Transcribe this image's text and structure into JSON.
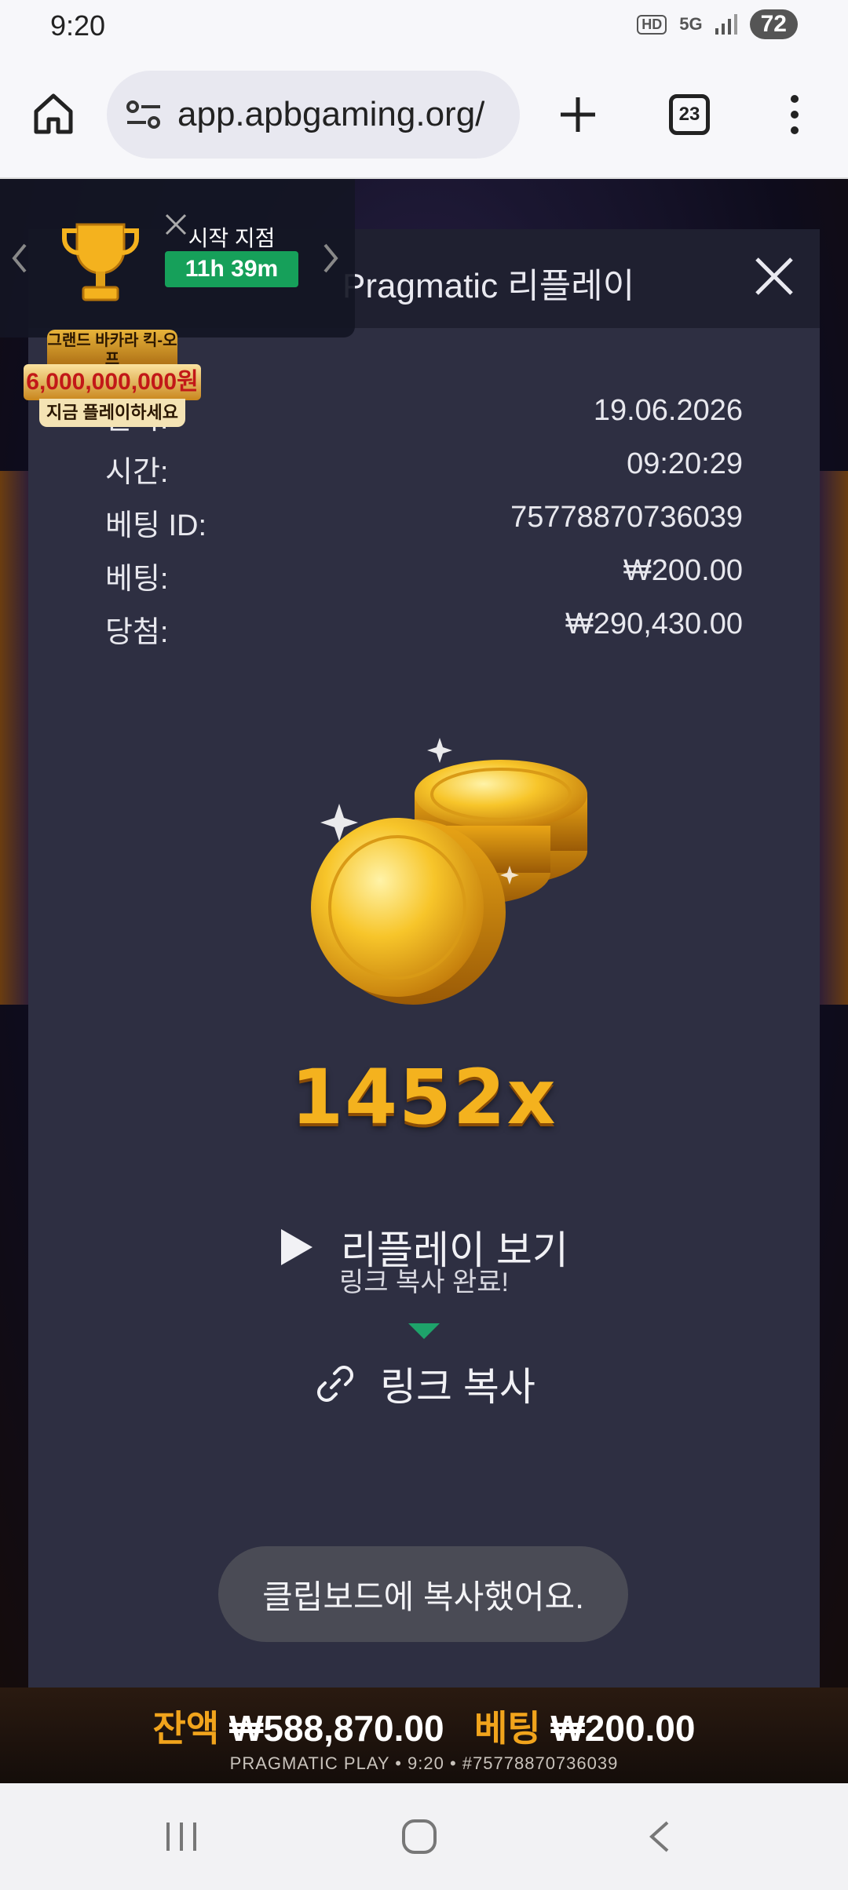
{
  "status_bar": {
    "time": "9:20",
    "hd": "HD",
    "network": "5G",
    "battery": "72"
  },
  "browser": {
    "url": "app.apbgaming.org/",
    "tab_count": "23"
  },
  "promo": {
    "label": "시작 지점",
    "timer": "11h 39m",
    "badge_title": "그랜드 바카라 킥-오프",
    "badge_amount": "6,000,000,000원",
    "badge_cta": "지금 플레이하세요"
  },
  "dialog": {
    "title": "Pragmatic 리플레이",
    "rows": [
      {
        "label": "날짜:",
        "value": "19.06.2026"
      },
      {
        "label": "시간:",
        "value": "09:20:29"
      },
      {
        "label": "베팅 ID:",
        "value": "75778870736039"
      },
      {
        "label": "베팅:",
        "value": "₩200.00"
      },
      {
        "label": "당첨:",
        "value": "₩290,430.00"
      }
    ],
    "multiplier": "1452x",
    "replay_label": "리플레이 보기",
    "tooltip": "링크 복사 완료!",
    "copy_link_label": "링크 복사",
    "toast": "클립보드에 복사했어요."
  },
  "bottom_bar": {
    "balance_label": "잔액",
    "balance_value": "₩588,870.00",
    "bet_label": "베팅",
    "bet_value": "₩200.00",
    "footer": "PRAGMATIC PLAY • 9:20 • #75778870736039"
  },
  "colors": {
    "accent_gold": "#f4b21e",
    "timer_green": "#16a05a",
    "dialog_bg": "#2e2f42"
  }
}
